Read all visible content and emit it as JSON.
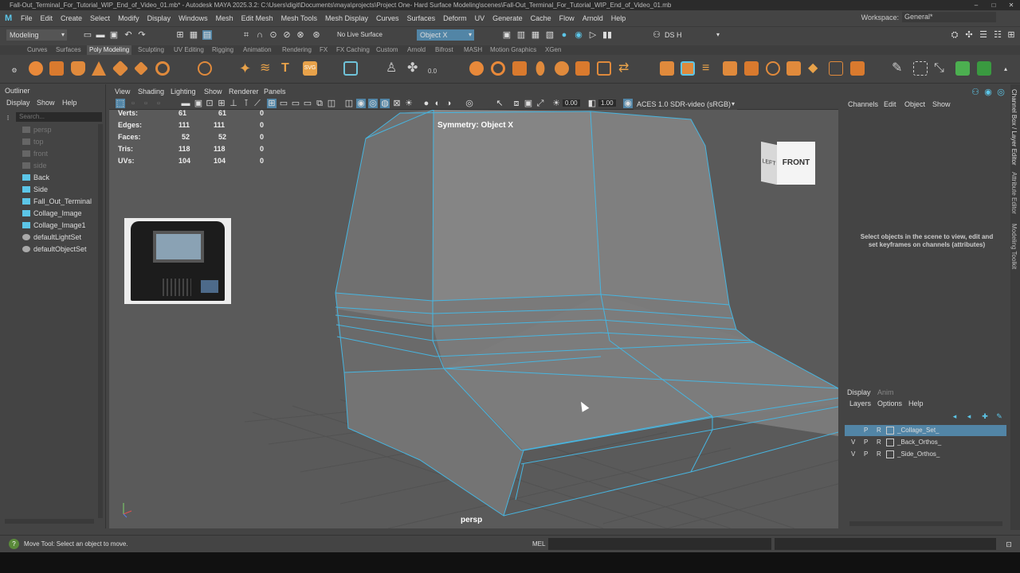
{
  "title_bar": {
    "text": "Fall-Out_Terminal_For_Tutorial_WIP_End_of_Video_01.mb* - Autodesk MAYA 2025.3.2: C:\\Users\\digit\\Documents\\maya\\projects\\Project One- Hard Surface Modeling\\scenes\\Fall-Out_Terminal_For_Tutorial_WIP_End_of_Video_01.mb"
  },
  "menu": [
    "File",
    "Edit",
    "Create",
    "Select",
    "Modify",
    "Display",
    "Windows",
    "Mesh",
    "Edit Mesh",
    "Mesh Tools",
    "Mesh Display",
    "Curves",
    "Surfaces",
    "Deform",
    "UV",
    "Generate",
    "Cache",
    "Flow",
    "Arnold",
    "Help"
  ],
  "workspace": {
    "label": "Workspace:",
    "value": "General*"
  },
  "status_line": {
    "menu_set": "Modeling",
    "live_surface": "No Live Surface",
    "symmetry": "Object X",
    "user": "DS H"
  },
  "shelf_tabs": [
    "Curves",
    "Surfaces",
    "Poly Modeling",
    "Sculpting",
    "UV Editing",
    "Rigging",
    "Animation",
    "Rendering",
    "FX",
    "FX Caching",
    "Custom",
    "Arnold",
    "Bifrost",
    "MASH",
    "Motion Graphics",
    "XGen"
  ],
  "shelf_values": {
    "mash_value": "0.0"
  },
  "outliner": {
    "title": "Outliner",
    "menus": [
      "Display",
      "Show",
      "Help"
    ],
    "search_placeholder": "Search...",
    "items": [
      "persp",
      "top",
      "front",
      "side",
      "Back",
      "Side",
      "Fall_Out_Terminal",
      "Collage_Image",
      "Collage_Image1",
      "defaultLightSet",
      "defaultObjectSet"
    ]
  },
  "viewport_menu": [
    "View",
    "Shading",
    "Lighting",
    "Show",
    "Renderer",
    "Panels"
  ],
  "viewport_toolbar": {
    "exposure": "0.00",
    "gamma": "1.00",
    "color_space": "ACES 1.0 SDR-video (sRGB)"
  },
  "hud": {
    "rows": [
      {
        "label": "Verts:",
        "a": "61",
        "b": "61",
        "c": "0"
      },
      {
        "label": "Edges:",
        "a": "111",
        "b": "111",
        "c": "0"
      },
      {
        "label": "Faces:",
        "a": "52",
        "b": "52",
        "c": "0"
      },
      {
        "label": "Tris:",
        "a": "118",
        "b": "118",
        "c": "0"
      },
      {
        "label": "UVs:",
        "a": "104",
        "b": "104",
        "c": "0"
      }
    ],
    "symmetry": "Symmetry: Object X",
    "camera": "persp"
  },
  "viewcube": {
    "left": "LEFT",
    "front": "FRONT"
  },
  "channel_box": {
    "menus": [
      "Channels",
      "Edit",
      "Object",
      "Show"
    ],
    "message": "Select objects in the scene to view, edit and set keyframes on channels (attributes)"
  },
  "layer_editor": {
    "tabs": [
      "Display",
      "Anim"
    ],
    "menus": [
      "Layers",
      "Options",
      "Help"
    ],
    "layers": [
      {
        "v": "",
        "p": "P",
        "r": "R",
        "name": "_Collage_Set_"
      },
      {
        "v": "V",
        "p": "P",
        "r": "R",
        "name": "_Back_Orthos_"
      },
      {
        "v": "V",
        "p": "P",
        "r": "R",
        "name": "_Side_Orthos_"
      }
    ]
  },
  "side_tabs": [
    "Channel Box / Layer Editor",
    "Attribute Editor",
    "Modeling Toolkit"
  ],
  "help_line": {
    "text": "Move Tool: Select an object to move.",
    "mel_label": "MEL"
  },
  "colors": {
    "accent": "#5cc6e8",
    "selection": "#5285a6",
    "wire": "#47b5e0"
  }
}
